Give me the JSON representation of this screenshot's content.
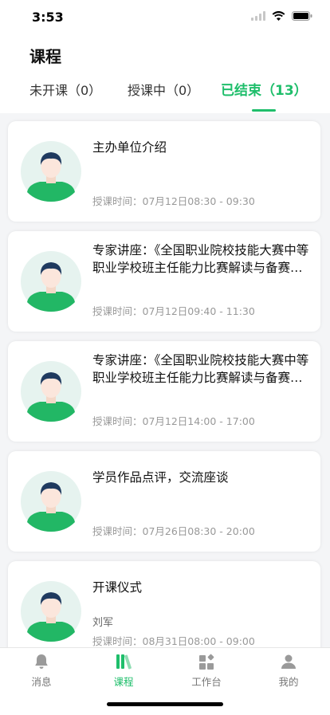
{
  "status_bar": {
    "time": "3:53"
  },
  "header": {
    "title": "课程"
  },
  "tabs": [
    {
      "label": "未开课（0）",
      "active": false
    },
    {
      "label": "授课中（0）",
      "active": false
    },
    {
      "label": "已结束（13）",
      "active": true
    }
  ],
  "courses": [
    {
      "title": "主办单位介绍",
      "time": "授课时间：07月12日08:30 - 09:30"
    },
    {
      "title": "专家讲座：《全国职业院校技能大赛中等职业学校班主任能力比赛解读与备赛指导》",
      "time": "授课时间：07月12日09:40 - 11:30"
    },
    {
      "title": "专家讲座：《全国职业院校技能大赛中等职业学校班主任能力比赛解读与备赛指导》",
      "time": "授课时间：07月12日14:00 - 17:00"
    },
    {
      "title": "学员作品点评，交流座谈",
      "time": "授课时间：07月26日08:30 - 20:00"
    },
    {
      "title": "开课仪式",
      "teacher": "刘军",
      "time": "授课时间：08月31日08:00 - 09:00"
    }
  ],
  "tabbar": [
    {
      "label": "消息",
      "icon": "bell-icon",
      "active": false
    },
    {
      "label": "课程",
      "icon": "books-icon",
      "active": true
    },
    {
      "label": "工作台",
      "icon": "grid-icon",
      "active": false
    },
    {
      "label": "我的",
      "icon": "person-icon",
      "active": false
    }
  ],
  "colors": {
    "accent": "#1fbe6b",
    "background": "#f4f5f7",
    "muted_text": "#999999"
  }
}
